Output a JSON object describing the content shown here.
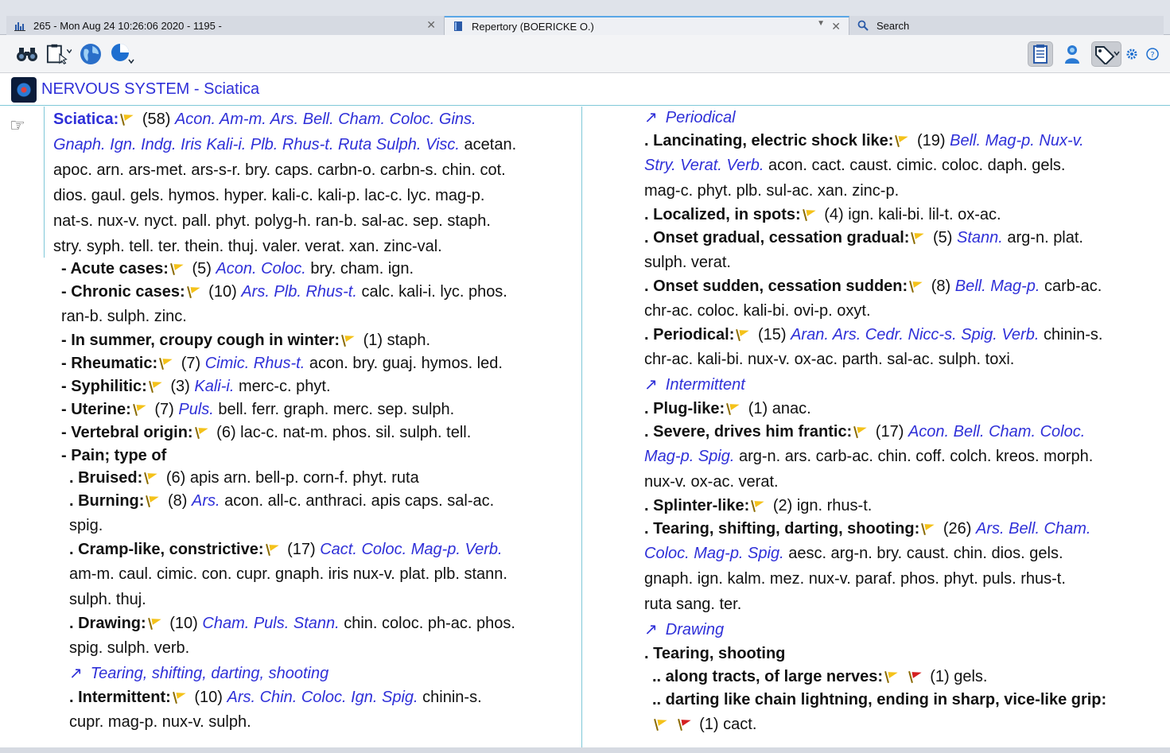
{
  "tabs": [
    {
      "label": "265 - Mon Aug 24 10:26:06 2020 - 1195 -",
      "icon": "chart-bars-icon"
    },
    {
      "label": "Repertory (BOERICKE O.)",
      "icon": "book-icon"
    },
    {
      "label": "Search",
      "icon": "magnifier-icon"
    }
  ],
  "toolbar": {
    "left": [
      "binoculars-icon",
      "clipboard-pointer-icon",
      "globe-icon",
      "pie-chart-icon"
    ],
    "right": [
      "notepad-icon",
      "person-icon",
      "tag-icon",
      "gear-icon",
      "help-icon"
    ]
  },
  "title": "NERVOUS SYSTEM - Sciatica",
  "left": {
    "main": {
      "rubric": "Sciatica:",
      "count": "(58)",
      "line1_rem": "Acon. Am-m. Ars. Bell. Cham. Coloc. Gins.",
      "line2_rem": "Gnaph. Ign. Indg. Iris Kali-i. Plb. Rhus-t. Ruta Sulph. Visc.",
      "line2_plain": " acetan.",
      "line3": "apoc. arn. ars-met. ars-s-r. bry. caps. carbn-o. carbn-s. chin. cot.",
      "line4": "dios. gaul. gels. hymos. hyper. kali-c. kali-p. lac-c. lyc. mag-p.",
      "line5": "nat-s. nux-v. nyct. pall. phyt. polyg-h. ran-b. sal-ac. sep. staph.",
      "line6": "stry. syph. tell. ter. thein. thuj. valer. verat. xan. zinc-val."
    },
    "acute": {
      "label": "- Acute cases:",
      "count": "(5)",
      "rem": "Acon. Coloc.",
      "plain": " bry. cham. ign."
    },
    "chronic": {
      "label": "- Chronic cases:",
      "count": "(10)",
      "rem": "Ars. Plb. Rhus-t.",
      "plain": " calc. kali-i. lyc. phos.",
      "plain2": "ran-b. sulph. zinc."
    },
    "summer": {
      "label": "- In summer, croupy cough in winter:",
      "count": "(1)",
      "plain": " staph."
    },
    "rheum": {
      "label": "- Rheumatic:",
      "count": "(7)",
      "rem": "Cimic. Rhus-t.",
      "plain": " acon. bry. guaj. hymos. led."
    },
    "syph": {
      "label": "- Syphilitic:",
      "count": "(3)",
      "rem": "Kali-i.",
      "plain": " merc-c. phyt."
    },
    "uterine": {
      "label": "- Uterine:",
      "count": "(7)",
      "rem": "Puls.",
      "plain": " bell. ferr. graph. merc. sep. sulph."
    },
    "vertebral": {
      "label": "- Vertebral origin:",
      "count": "(6)",
      "plain": " lac-c. nat-m. phos. sil. sulph. tell."
    },
    "pain": {
      "label": "- Pain; type of"
    },
    "bruised": {
      "label": ". Bruised:",
      "count": "(6)",
      "plain": " apis arn. bell-p. corn-f. phyt. ruta"
    },
    "burning": {
      "label": ". Burning:",
      "count": "(8)",
      "rem": "Ars.",
      "plain": " acon. all-c. anthraci. apis caps. sal-ac.",
      "plain2": "spig."
    },
    "cramp": {
      "label": ". Cramp-like, constrictive:",
      "count": "(17)",
      "rem": "Cact. Coloc. Mag-p. Verb.",
      "plain2": "am-m. caul. cimic. con. cupr. gnaph. iris nux-v. plat. plb. stann.",
      "plain3": "sulph. thuj."
    },
    "drawing": {
      "label": ". Drawing:",
      "count": "(10)",
      "rem": "Cham. Puls. Stann.",
      "plain": " chin. coloc. ph-ac. phos.",
      "plain2": "spig. sulph. verb."
    },
    "xref_tearing": "Tearing, shifting, darting, shooting",
    "intermittent": {
      "label": ". Intermittent:",
      "count": "(10)",
      "rem": "Ars. Chin. Coloc. Ign. Spig.",
      "plain": " chinin-s.",
      "plain2": "cupr. mag-p. nux-v. sulph."
    }
  },
  "right": {
    "xref_periodical": "Periodical",
    "lancinating": {
      "label": ". Lancinating, electric shock like:",
      "count": "(19)",
      "rem": "Bell. Mag-p. Nux-v.",
      "rem2": "Stry. Verat. Verb.",
      "plain2": " acon. cact. caust. cimic. coloc. daph. gels.",
      "plain3": "mag-c. phyt. plb. sul-ac. xan. zinc-p."
    },
    "localized": {
      "label": ". Localized, in spots:",
      "count": "(4)",
      "plain": " ign. kali-bi. lil-t. ox-ac."
    },
    "onset_grad": {
      "label": ". Onset gradual, cessation gradual:",
      "count": "(5)",
      "rem": "Stann.",
      "plain": " arg-n. plat.",
      "plain2": "sulph. verat."
    },
    "onset_sudden": {
      "label": ". Onset sudden, cessation sudden:",
      "count": "(8)",
      "rem": "Bell. Mag-p.",
      "plain": " carb-ac.",
      "plain2": "chr-ac. coloc. kali-bi. ovi-p. oxyt."
    },
    "periodical": {
      "label": ". Periodical:",
      "count": "(15)",
      "rem": "Aran. Ars. Cedr. Nicc-s. Spig. Verb.",
      "plain": " chinin-s.",
      "plain2": "chr-ac. kali-bi. nux-v. ox-ac. parth. sal-ac. sulph. toxi."
    },
    "xref_intermittent": "Intermittent",
    "plug": {
      "label": ". Plug-like:",
      "count": "(1)",
      "plain": " anac."
    },
    "severe": {
      "label": ". Severe, drives him frantic:",
      "count": "(17)",
      "rem": "Acon. Bell. Cham. Coloc.",
      "rem2": "Mag-p. Spig.",
      "plain2": " arg-n. ars. carb-ac. chin. coff. colch. kreos. morph.",
      "plain3": "nux-v. ox-ac. verat."
    },
    "splinter": {
      "label": ". Splinter-like:",
      "count": "(2)",
      "plain": " ign. rhus-t."
    },
    "tearing": {
      "label": ". Tearing, shifting, darting, shooting:",
      "count": "(26)",
      "rem": "Ars. Bell. Cham.",
      "rem2": "Coloc. Mag-p. Spig.",
      "plain2": " aesc. arg-n. bry. caust. chin. dios. gels.",
      "plain3": "gnaph. ign. kalm. mez. nux-v. paraf. phos. phyt. puls. rhus-t.",
      "plain4": "ruta sang. ter."
    },
    "xref_drawing": "Drawing",
    "tearing_shooting": {
      "label": ". Tearing, shooting"
    },
    "tracts": {
      "label": ".. along tracts, of large nerves:",
      "count": "(1)",
      "plain": " gels."
    },
    "darting": {
      "label": ".. darting like chain lightning, ending in sharp, vice-like grip:",
      "count": "(1)",
      "plain": " cact."
    }
  }
}
